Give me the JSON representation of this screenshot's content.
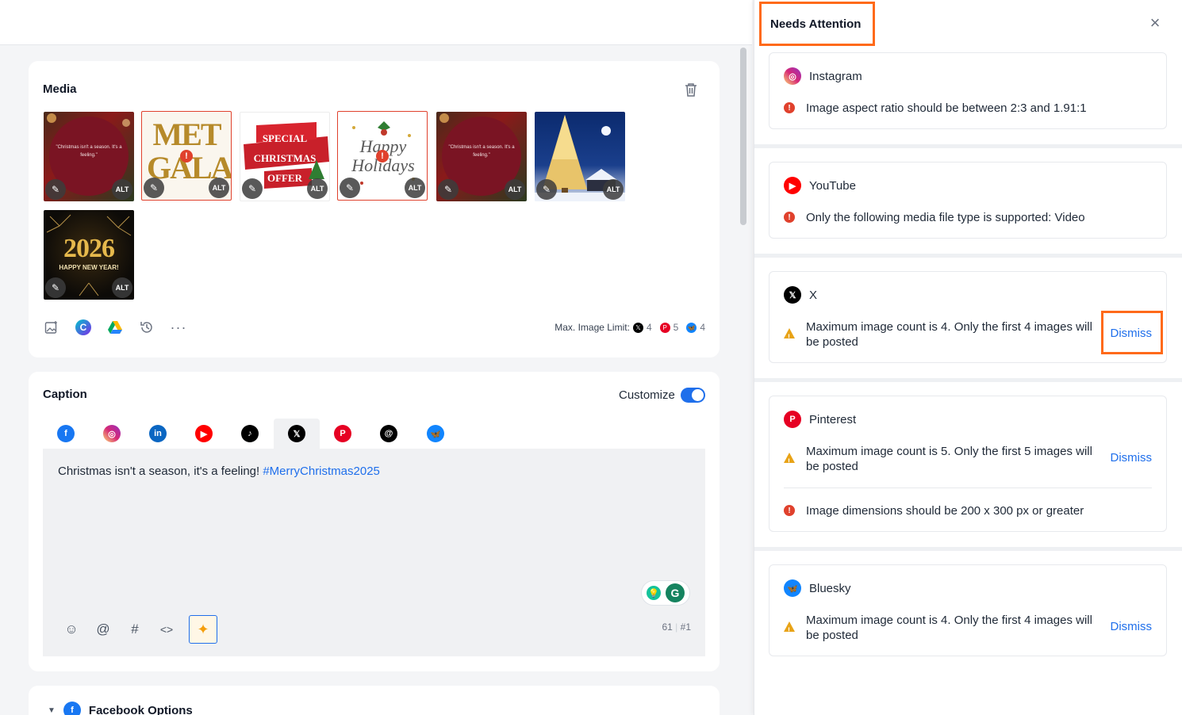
{
  "media": {
    "title": "Media",
    "thumbs": [
      {
        "alt": "ALT",
        "quote": "\"Christmas isn't a season. It's a feeling.\""
      },
      {
        "alt": "ALT",
        "art": "MET GALA"
      },
      {
        "alt": "ALT",
        "art": "SPECIAL CHRISTMAS OFFER"
      },
      {
        "alt": "ALT",
        "art": "Happy Holidays"
      },
      {
        "alt": "ALT",
        "quote": "\"Christmas isn't a season. It's a feeling.\""
      },
      {
        "alt": "ALT"
      },
      {
        "alt": "ALT",
        "art": "2026",
        "sub": "HAPPY NEW YEAR!"
      }
    ],
    "limit_label": "Max. Image Limit:",
    "limits": [
      {
        "platform": "x",
        "count": "4"
      },
      {
        "platform": "pinterest",
        "count": "5"
      },
      {
        "platform": "bluesky",
        "count": "4"
      }
    ]
  },
  "caption": {
    "title": "Caption",
    "customize_label": "Customize",
    "text": "Christmas isn't a season, it's a feeling! ",
    "hashtag": "#MerryChristmas2025",
    "char_count": "61",
    "post_index": "#1"
  },
  "facebook_options": {
    "label": "Facebook Options"
  },
  "panel": {
    "title": "Needs Attention",
    "dismiss_label": "Dismiss",
    "issues": [
      {
        "platform": "Instagram",
        "messages": [
          {
            "type": "error",
            "text": "Image aspect ratio should be between 2:3 and 1.91:1"
          }
        ]
      },
      {
        "platform": "YouTube",
        "messages": [
          {
            "type": "error",
            "text": "Only the following media file type is supported: Video"
          }
        ]
      },
      {
        "platform": "X",
        "messages": [
          {
            "type": "warning",
            "text": "Maximum image count is 4. Only the first 4 images will be posted"
          }
        ]
      },
      {
        "platform": "Pinterest",
        "messages": [
          {
            "type": "warning",
            "text": "Maximum image count is 5. Only the first 5 images will be posted"
          },
          {
            "type": "error",
            "text": "Image dimensions should be 200 x 300 px or greater"
          }
        ]
      },
      {
        "platform": "Bluesky",
        "messages": [
          {
            "type": "warning",
            "text": "Maximum image count is 4. Only the first 4 images will be posted"
          }
        ]
      }
    ]
  },
  "colors": {
    "accent": "#1f6feb",
    "highlight": "#ff6a1a",
    "error": "#e0412d",
    "warning": "#e8a317"
  }
}
